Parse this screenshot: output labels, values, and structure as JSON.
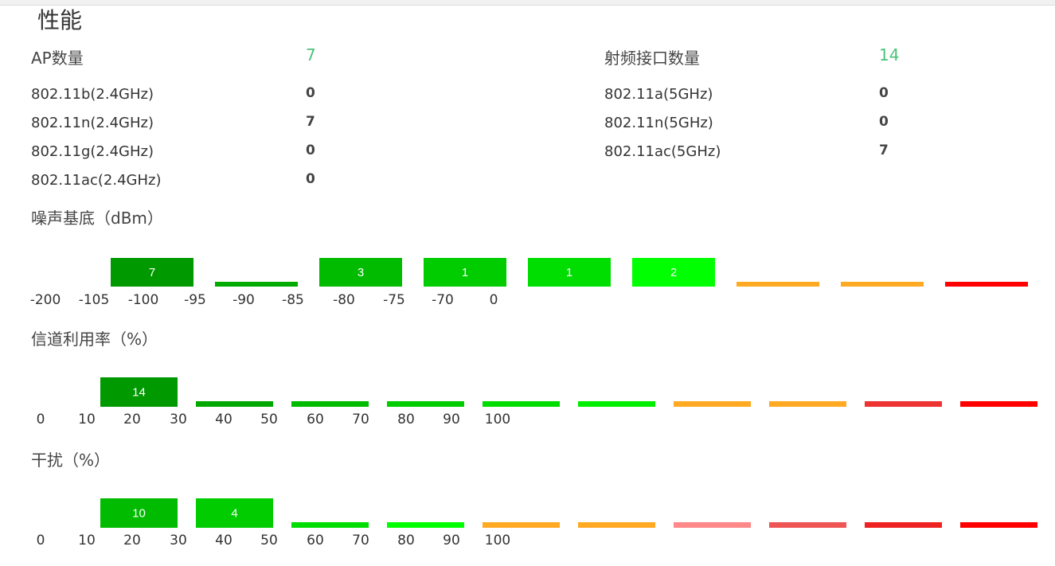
{
  "page": {
    "title": "性能"
  },
  "summary": {
    "ap_count_label": "AP数量",
    "ap_count_value": "7",
    "radio_count_label": "射频接口数量",
    "radio_count_value": "14",
    "ap_modes": [
      {
        "label": "802.11b(2.4GHz)",
        "value": "0"
      },
      {
        "label": "802.11n(2.4GHz)",
        "value": "7"
      },
      {
        "label": "802.11g(2.4GHz)",
        "value": "0"
      },
      {
        "label": "802.11ac(2.4GHz)",
        "value": "0"
      }
    ],
    "radio_modes": [
      {
        "label": "802.11a(5GHz)",
        "value": "0"
      },
      {
        "label": "802.11n(5GHz)",
        "value": "0"
      },
      {
        "label": "802.11ac(5GHz)",
        "value": "7"
      }
    ]
  },
  "chart_data": [
    {
      "type": "bar",
      "title": "噪声基底（dBm）",
      "tick_labels": [
        "-200",
        "-105",
        "-100",
        "-95",
        "-90",
        "-85",
        "-80",
        "-75",
        "-70",
        "0"
      ],
      "values": [
        7,
        0,
        3,
        1,
        1,
        2,
        0,
        0,
        0
      ],
      "bar_labels": [
        "7",
        "",
        "3",
        "1",
        "1",
        "2",
        "",
        "",
        ""
      ],
      "colors": [
        "#009900",
        "#00aa00",
        "#00bb00",
        "#00cc00",
        "#00dd00",
        "#00ff00",
        "#ffaa22",
        "#ffaa22",
        "#ff0000"
      ]
    },
    {
      "type": "bar",
      "title": "信道利用率（%）",
      "tick_labels": [
        "0",
        "10",
        "20",
        "30",
        "40",
        "50",
        "60",
        "70",
        "80",
        "90",
        "100"
      ],
      "values": [
        14,
        0,
        0,
        0,
        0,
        0,
        0,
        0,
        0,
        0
      ],
      "bar_labels": [
        "14",
        "",
        "",
        "",
        "",
        "",
        "",
        "",
        "",
        ""
      ],
      "colors": [
        "#009900",
        "#00a800",
        "#00bb00",
        "#00cc00",
        "#00dd00",
        "#00ee00",
        "#ffaa22",
        "#ffaa22",
        "#ee3333",
        "#ff0000"
      ]
    },
    {
      "type": "bar",
      "title": "干扰（%）",
      "tick_labels": [
        "0",
        "10",
        "20",
        "30",
        "40",
        "50",
        "60",
        "70",
        "80",
        "90",
        "100"
      ],
      "values": [
        10,
        4,
        0,
        0,
        0,
        0,
        0,
        0,
        0,
        0
      ],
      "bar_labels": [
        "10",
        "4",
        "",
        "",
        "",
        "",
        "",
        "",
        "",
        ""
      ],
      "colors": [
        "#00bb00",
        "#00cc00",
        "#00dd00",
        "#00ff00",
        "#ffaa22",
        "#ffaa22",
        "#ff8888",
        "#ee5555",
        "#ee2222",
        "#ff0000"
      ]
    }
  ]
}
